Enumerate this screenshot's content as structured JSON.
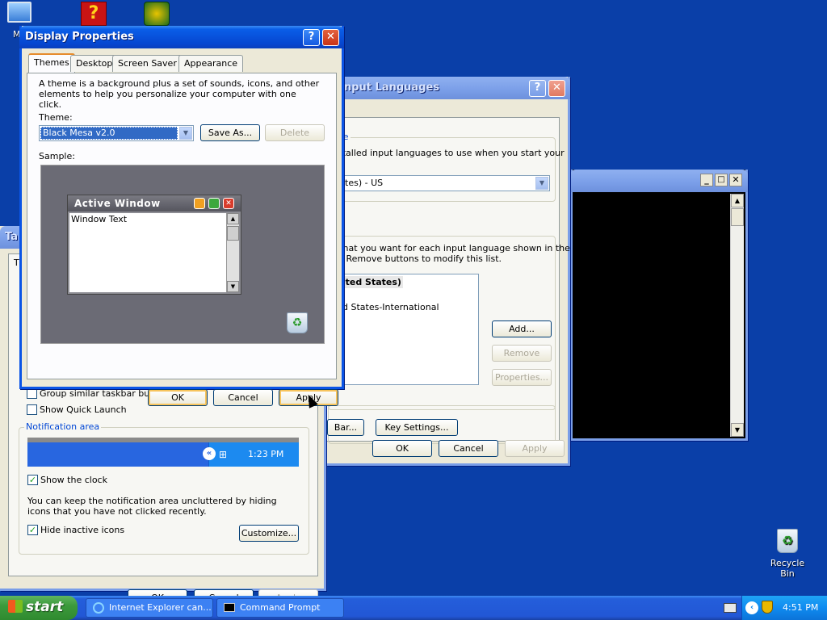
{
  "desktop": {
    "icons": [
      {
        "label": "My",
        "glyph": "monitor-icon"
      },
      {
        "label": "Recycle Bin",
        "glyph": "recycle-bin-icon"
      }
    ]
  },
  "display_properties": {
    "title": "Display Properties",
    "tabs": [
      "Themes",
      "Desktop",
      "Screen Saver",
      "Appearance"
    ],
    "description": "A theme is a background plus a set of sounds, icons, and other elements to help you personalize your computer with one click.",
    "theme_label": "Theme:",
    "theme_value": "Black Mesa v2.0",
    "save_as": "Save As...",
    "delete": "Delete",
    "sample_label": "Sample:",
    "sample_window_title": "Active Window",
    "sample_window_text": "Window Text",
    "ok": "OK",
    "cancel": "Cancel",
    "apply": "Apply"
  },
  "input_languages": {
    "title": "nput Languages",
    "group1_label": "age",
    "group1_text": "nstalled input languages to use when you start your",
    "lang_value": "tates) - US",
    "group2_text_1": "s that you want for each input language shown in the",
    "group2_text_2": "nd Remove buttons to modify this list.",
    "list_item_1": "nited States)",
    "list_item_2": "d States-International",
    "add": "Add...",
    "remove": "Remove",
    "properties": "Properties...",
    "bar": "Bar...",
    "key_settings": "Key Settings...",
    "ok": "OK",
    "cancel": "Cancel",
    "apply": "Apply"
  },
  "taskbar_properties": {
    "title_fragment": "Ta",
    "fragment": "T",
    "group_similar": "Group similar taskbar buttons",
    "show_quick_launch": "Show Quick Launch",
    "notification_area": "Notification area",
    "preview_time": "1:23 PM",
    "show_clock": "Show the clock",
    "hide_text": "You can keep the notification area uncluttered by hiding icons that you have not clicked recently.",
    "hide_inactive": "Hide inactive icons",
    "customize": "Customize...",
    "ok": "OK",
    "cancel": "Cancel",
    "apply": "Apply"
  },
  "taskbar": {
    "start": "start",
    "items": [
      "Internet Explorer can...",
      "Command Prompt"
    ],
    "clock": "4:51 PM"
  },
  "colors": {
    "desktop": "#0a3fa8",
    "taskbar": "#245edb",
    "start": "#3c9a3c",
    "tray": "#0f8bf0"
  }
}
